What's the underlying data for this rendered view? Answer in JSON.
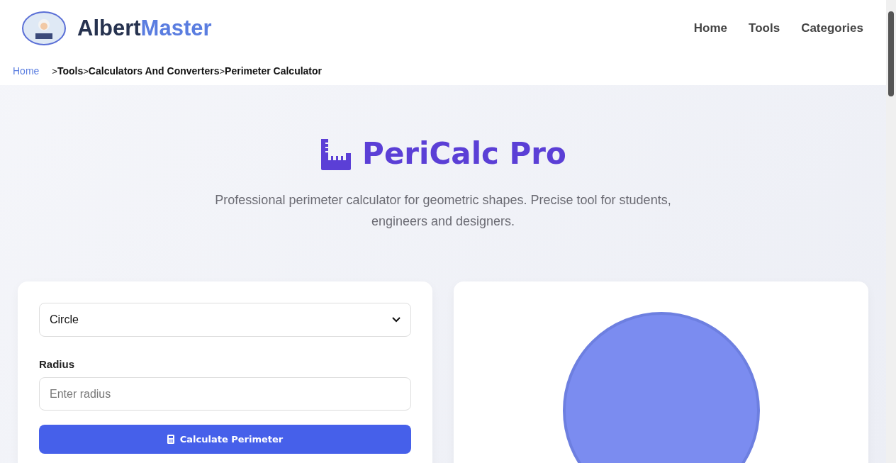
{
  "header": {
    "logo": {
      "primary": "Albert",
      "accent": "Master"
    },
    "nav": [
      "Home",
      "Tools",
      "Categories"
    ]
  },
  "breadcrumb": {
    "separator": ">",
    "items": [
      "Home",
      "Tools",
      "Calculators And Converters",
      "Perimeter Calculator"
    ]
  },
  "hero": {
    "title": "PeriCalc Pro",
    "subtitle": "Professional perimeter calculator for geometric shapes. Precise tool for students, engineers and designers."
  },
  "form": {
    "shape": "Circle",
    "fields": [
      {
        "label": "Radius",
        "placeholder": "Enter radius"
      }
    ],
    "button": "Calculate Perimeter"
  },
  "preview": {
    "kind": "circle"
  }
}
